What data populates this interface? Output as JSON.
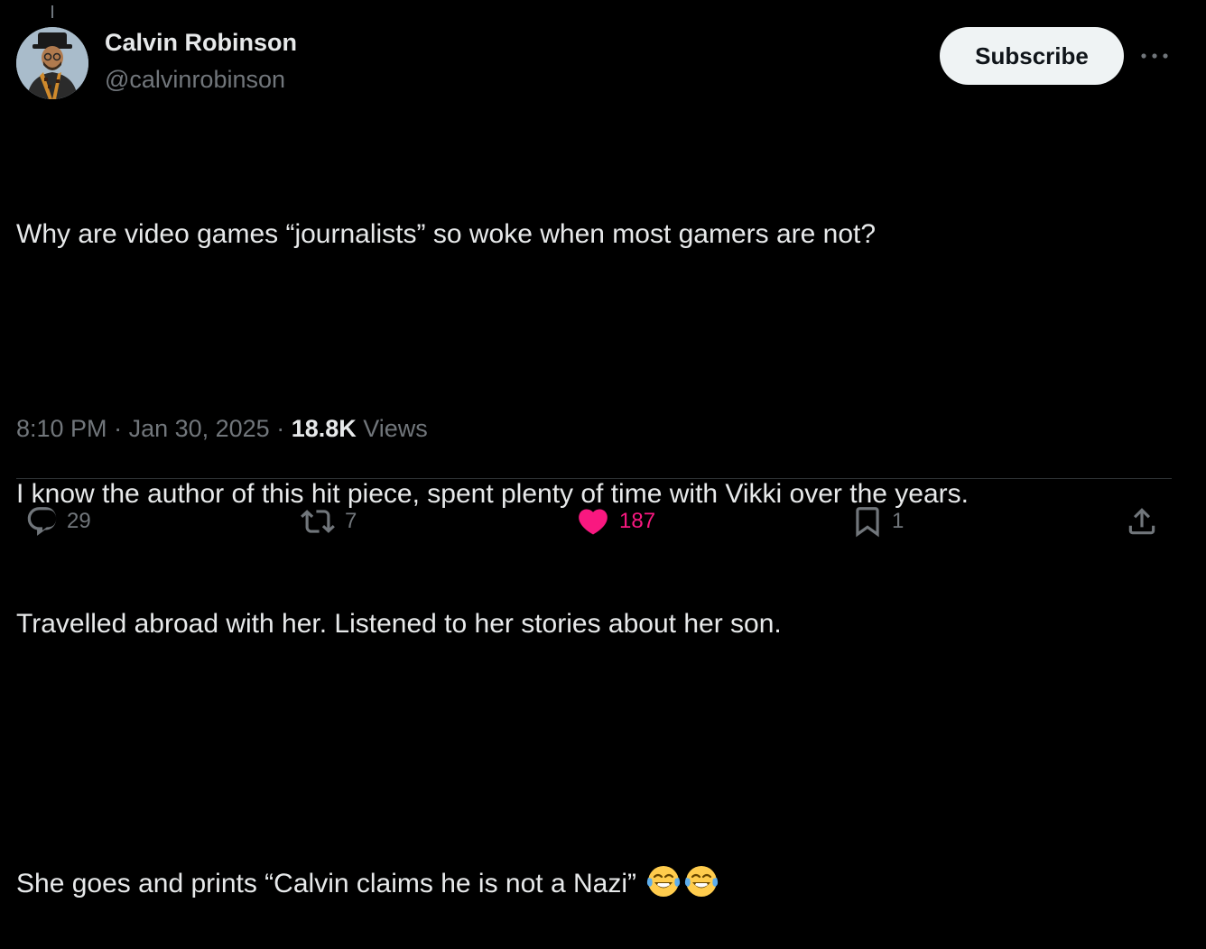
{
  "author": {
    "display_name": "Calvin Robinson",
    "handle": "@calvinrobinson",
    "avatar": "avatar"
  },
  "header": {
    "subscribe_label": "Subscribe",
    "more_icon": "more-icon"
  },
  "tweet": {
    "lines": [
      "Why are video games “journalists” so woke when most gamers are not?",
      "",
      "I know the author of this hit piece, spent plenty of time with Vikki over the years.",
      "Travelled abroad with her. Listened to her stories about her son.",
      "",
      "She goes and prints “Calvin claims he is not a Nazi” "
    ],
    "emojis": [
      "face-with-tears-of-joy",
      "face-with-tears-of-joy"
    ]
  },
  "meta": {
    "time": "8:10 PM",
    "separator": " · ",
    "date": "Jan 30, 2025",
    "separator2": " · ",
    "views_count": "18.8K",
    "views_label": " Views"
  },
  "actions": {
    "replies": {
      "icon": "reply-icon",
      "count": "29"
    },
    "reposts": {
      "icon": "repost-icon",
      "count": "7"
    },
    "likes": {
      "icon": "heart-icon",
      "count": "187",
      "color": "#f91880"
    },
    "bookmarks": {
      "icon": "bookmark-icon",
      "count": "1"
    },
    "share": {
      "icon": "share-icon"
    }
  },
  "colors": {
    "background": "#000000",
    "text_primary": "#e7e9ea",
    "text_secondary": "#71767b",
    "like_accent": "#f91880",
    "subscribe_bg": "#eff3f4"
  }
}
